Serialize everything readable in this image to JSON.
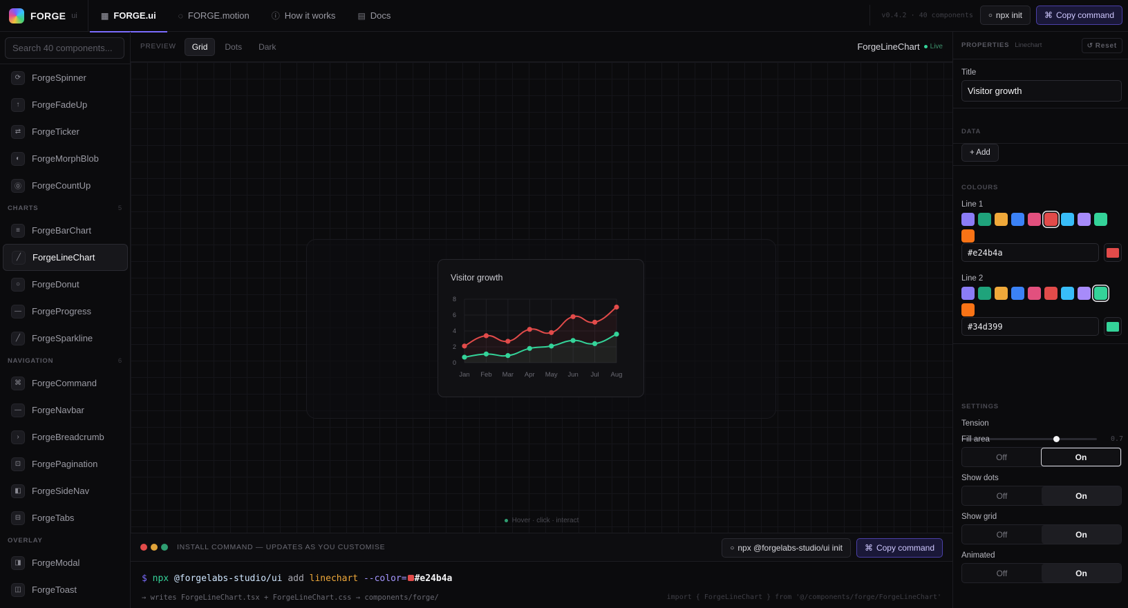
{
  "header": {
    "brand": "FORGE",
    "brand_sub": "ui",
    "tabs": [
      {
        "label": "FORGE.ui",
        "icon": "grid-icon",
        "active": true
      },
      {
        "label": "FORGE.motion",
        "icon": "motion-icon",
        "active": false
      },
      {
        "label": "How it works",
        "icon": "info-icon",
        "active": false
      },
      {
        "label": "Docs",
        "icon": "doc-icon",
        "active": false
      }
    ],
    "version": "v0.4.2 · 40 components",
    "init_label": "npx init",
    "copy_label": "Copy command"
  },
  "sidebar": {
    "search_placeholder": "Search 40 components...",
    "items_top": [
      {
        "label": "ForgeSpinner",
        "icon": "spinner-icon",
        "glyph": "⟳"
      },
      {
        "label": "ForgeFadeUp",
        "icon": "arrow-up-icon",
        "glyph": "↑"
      },
      {
        "label": "ForgeTicker",
        "icon": "swap-icon",
        "glyph": "⇄"
      },
      {
        "label": "ForgeMorphBlob",
        "icon": "blob-icon",
        "glyph": "◐"
      },
      {
        "label": "ForgeCountUp",
        "icon": "counter-icon",
        "glyph": "⓪"
      }
    ],
    "group_charts": {
      "label": "CHARTS",
      "count": "5"
    },
    "items_charts": [
      {
        "label": "ForgeBarChart",
        "icon": "bar-chart-icon",
        "glyph": "≡"
      },
      {
        "label": "ForgeLineChart",
        "icon": "line-chart-icon",
        "glyph": "╱",
        "active": true
      },
      {
        "label": "ForgeDonut",
        "icon": "donut-icon",
        "glyph": "○"
      },
      {
        "label": "ForgeProgress",
        "icon": "progress-icon",
        "glyph": "—"
      },
      {
        "label": "ForgeSparkline",
        "icon": "sparkline-icon",
        "glyph": "╱"
      }
    ],
    "group_navigation": {
      "label": "NAVIGATION",
      "count": "6"
    },
    "items_navigation": [
      {
        "label": "ForgeCommand",
        "icon": "command-icon",
        "glyph": "⌘"
      },
      {
        "label": "ForgeNavbar",
        "icon": "navbar-icon",
        "glyph": "—"
      },
      {
        "label": "ForgeBreadcrumb",
        "icon": "chevron-right-icon",
        "glyph": "›"
      },
      {
        "label": "ForgePagination",
        "icon": "pagination-icon",
        "glyph": "⊡"
      },
      {
        "label": "ForgeSideNav",
        "icon": "sidenav-icon",
        "glyph": "◧"
      },
      {
        "label": "ForgeTabs",
        "icon": "tabs-icon",
        "glyph": "⊟"
      }
    ],
    "group_overlay": {
      "label": "OVERLAY",
      "count": ""
    },
    "items_overlay": [
      {
        "label": "ForgeModal",
        "icon": "modal-icon",
        "glyph": "◨"
      },
      {
        "label": "ForgeToast",
        "icon": "toast-icon",
        "glyph": "◫"
      }
    ]
  },
  "preview": {
    "label": "PREVIEW",
    "modes": [
      "Grid",
      "Dots",
      "Dark"
    ],
    "active_mode": "Grid",
    "component_name": "ForgeLineChart",
    "live_label": "Live",
    "hint": "Hover · click · interact"
  },
  "chart_data": {
    "type": "line",
    "title": "Visitor growth",
    "categories": [
      "Jan",
      "Feb",
      "Mar",
      "Apr",
      "May",
      "Jun",
      "Jul",
      "Aug"
    ],
    "ylim": [
      0,
      8
    ],
    "yticks": [
      0,
      2,
      4,
      6,
      8
    ],
    "grid": true,
    "fill": true,
    "dots": true,
    "series": [
      {
        "values": [
          2.1,
          3.4,
          2.7,
          4.2,
          3.8,
          5.8,
          5.1,
          7.0
        ],
        "color": "#e24b4a"
      },
      {
        "values": [
          0.7,
          1.1,
          0.9,
          1.8,
          2.1,
          2.8,
          2.4,
          3.6
        ],
        "color": "#34d399"
      }
    ]
  },
  "install": {
    "title": "INSTALL COMMAND — UPDATES AS YOU CUSTOMISE",
    "init_label": "npx @forgelabs-studio/ui init",
    "copy_label": "Copy command",
    "cmd_dollar": "$",
    "cmd_npx": "npx",
    "cmd_pkg": "@forgelabs-studio/ui",
    "cmd_add": "add",
    "cmd_comp": "linechart",
    "cmd_flag": "--color=",
    "cmd_hex": "#e24b4a",
    "writes": "→ writes ForgeLineChart.tsx + ForgeLineChart.css → components/forge/",
    "import_line": "import { ForgeLineChart } from '@/components/forge/ForgeLineChart'"
  },
  "properties": {
    "header": "PROPERTIES",
    "subheader": "Linechart",
    "reset_label": "Reset",
    "title_label": "Title",
    "title_value": "Visitor growth",
    "data_label": "DATA",
    "add_label": "+ Add",
    "colours_label": "COLOURS",
    "palette": [
      "#8b7cf6",
      "#1fa37b",
      "#f0a93a",
      "#3b82f6",
      "#e2507e",
      "#e24b4a",
      "#38bdf8",
      "#a78bfa",
      "#34d399",
      "#f97316"
    ],
    "line1_label": "Line 1",
    "line1_hex": "#e24b4a",
    "line2_label": "Line 2",
    "line2_hex": "#34d399",
    "settings_label": "SETTINGS",
    "tension_label": "Tension",
    "tension_value": "0.7",
    "toggles": [
      {
        "label": "Fill area",
        "off": "Off",
        "on": "On",
        "value": true
      },
      {
        "label": "Show dots",
        "off": "Off",
        "on": "On",
        "value": true
      },
      {
        "label": "Show grid",
        "off": "Off",
        "on": "On",
        "value": true
      },
      {
        "label": "Animated",
        "off": "Off",
        "on": "On",
        "value": true
      }
    ]
  }
}
